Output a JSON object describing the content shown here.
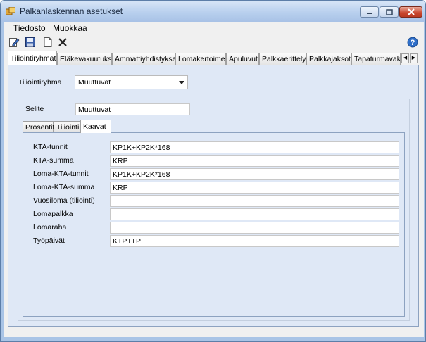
{
  "window": {
    "title": "Palkanlaskennan asetukset"
  },
  "menu": {
    "items": [
      "Tiedosto",
      "Muokkaa"
    ]
  },
  "toolbar": {
    "icons": [
      "edit-icon",
      "save-icon",
      "new-document-icon",
      "delete-icon",
      "help-icon"
    ],
    "help_glyph": "?"
  },
  "tabs": [
    "Tiliöintiryhmät",
    "Eläkevakuutukset",
    "Ammattiyhdistykset",
    "Lomakertoimet",
    "Apuluvut",
    "Palkkaerittely",
    "Palkkajaksot",
    "Tapaturmavakuu"
  ],
  "group_selector": {
    "label": "Tiliöintiryhmä",
    "value": "Muuttuvat"
  },
  "description": {
    "label": "Selite",
    "value": "Muuttuvat"
  },
  "subtabs": [
    "Prosentit",
    "Tiliöinti",
    "Kaavat"
  ],
  "formulas": [
    {
      "label": "KTA-tunnit",
      "value": "KP1K+KP2K*168"
    },
    {
      "label": "KTA-summa",
      "value": "KRP"
    },
    {
      "label": "Loma-KTA-tunnit",
      "value": "KP1K+KP2K*168"
    },
    {
      "label": "Loma-KTA-summa",
      "value": "KRP"
    },
    {
      "label": "Vuosiloma (tiliöinti)",
      "value": ""
    },
    {
      "label": "Lomapalkka",
      "value": ""
    },
    {
      "label": "Lomaraha",
      "value": ""
    },
    {
      "label": "Työpäivät",
      "value": "KTP+TP"
    }
  ],
  "colors": {
    "window_frame": "#a9c4e6",
    "panel_bg": "#dfe8f6",
    "close_button": "#c9452c"
  }
}
